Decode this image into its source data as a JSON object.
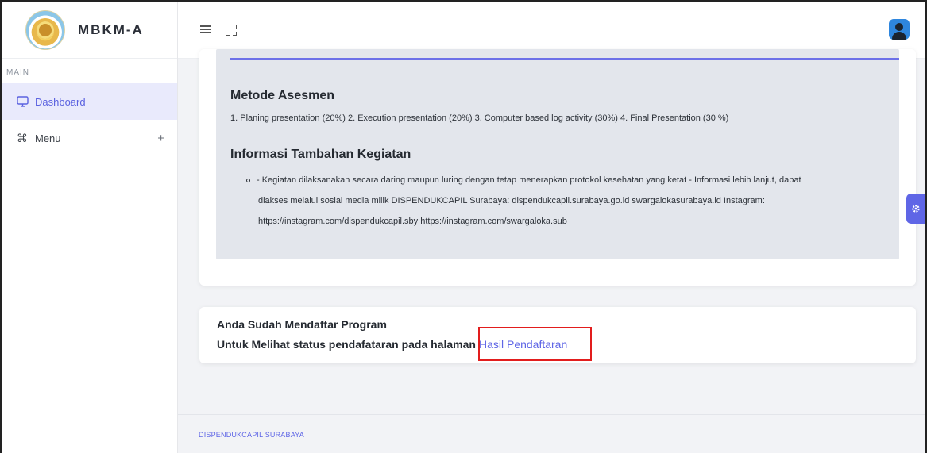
{
  "brand": {
    "name": "MBKM-A"
  },
  "sidebar": {
    "section_label": "MAIN",
    "items": [
      {
        "label": "Dashboard",
        "icon": "monitor-icon",
        "active": true
      },
      {
        "label": "Menu",
        "icon": "command-icon",
        "expand_symbol": "+"
      }
    ]
  },
  "content": {
    "metode": {
      "title": "Metode Asesmen",
      "text": "1. Planing presentation (20%) 2. Execution presentation (20%) 3. Computer based log activity (30%) 4. Final Presentation (30 %)"
    },
    "informasi": {
      "title": "Informasi Tambahan Kegiatan",
      "lines": [
        "- Kegiatan dilaksanakan secara daring maupun luring dengan tetap menerapkan protokol kesehatan yang ketat - Informasi lebih lanjut, dapat",
        "diakses melalui sosial media milik DISPENDUKCAPIL Surabaya: dispendukcapil.surabaya.go.id swargalokasurabaya.id Instagram:",
        "https://instagram.com/dispendukcapil.sby https://instagram.com/swargaloka.sub"
      ]
    },
    "registration": {
      "line1": "Anda Sudah Mendaftar Program",
      "line2": "Untuk Melihat status pendafataran pada halaman",
      "link_label": "Hasil Pendaftaran"
    }
  },
  "footer": {
    "text": "DISPENDUKCAPIL SURABAYA"
  },
  "colors": {
    "accent": "#5f66e6",
    "highlight": "#e21d1d",
    "panel": "#e3e6ec"
  }
}
